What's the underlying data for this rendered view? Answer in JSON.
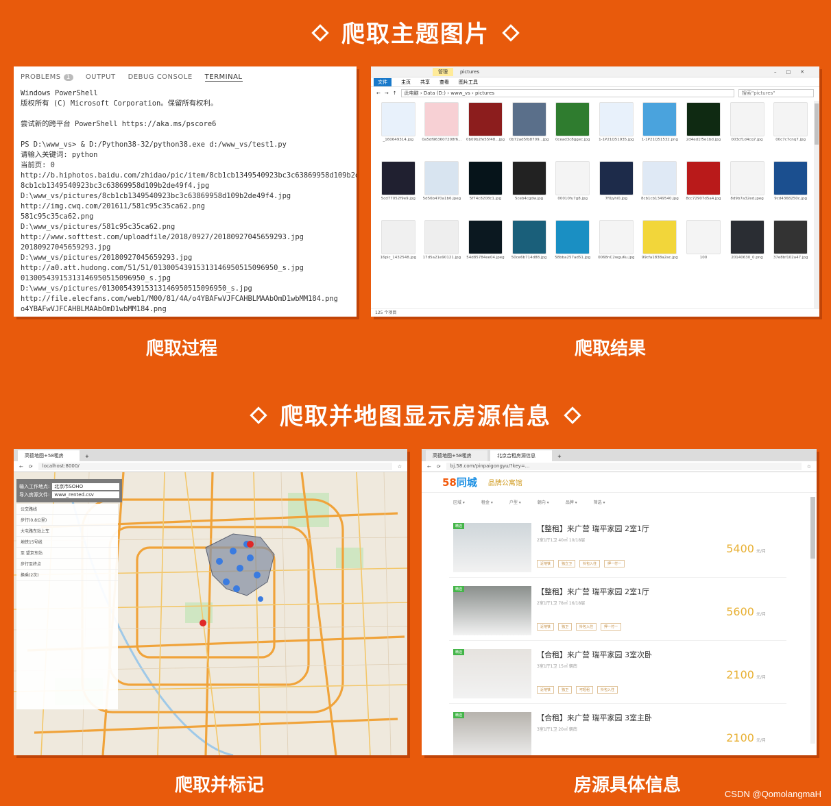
{
  "sections": {
    "top_title": "爬取主题图片",
    "bottom_title": "爬取并地图显示房源信息"
  },
  "captions": {
    "process": "爬取过程",
    "result": "爬取结果",
    "mark": "爬取并标记",
    "detail": "房源具体信息"
  },
  "terminal": {
    "tabs": [
      {
        "label": "PROBLEMS",
        "badge": "1"
      },
      {
        "label": "OUTPUT"
      },
      {
        "label": "DEBUG CONSOLE"
      },
      {
        "label": "TERMINAL"
      }
    ],
    "lines": [
      "Windows PowerShell",
      "版权所有 (C) Microsoft Corporation。保留所有权利。",
      "",
      "尝试新的跨平台 PowerShell https://aka.ms/pscore6",
      "",
      "PS D:\\www_vs> & D:/Python38-32/python38.exe d:/www_vs/test1.py",
      "请输入关键词: python",
      "当前页: 0",
      "http://b.hiphotos.baidu.com/zhidao/pic/item/8cb1cb1349540923bc3c63869958d109b2de",
      "8cb1cb1349540923bc3c63869958d109b2de49f4.jpg",
      "D:\\www_vs/pictures/8cb1cb1349540923bc3c63869958d109b2de49f4.jpg",
      "http://img.cwq.com/201611/581c95c35ca62.png",
      "581c95c35ca62.png",
      "D:\\www_vs/pictures/581c95c35ca62.png",
      "http://www.softtest.com/uploadfile/2018/0927/20180927045659293.jpg",
      "20180927045659293.jpg",
      "D:\\www_vs/pictures/20180927045659293.jpg",
      "http://a0.att.hudong.com/51/51/01300543915313146950515096950_s.jpg",
      "01300543915313146950515096950_s.jpg",
      "D:\\www_vs/pictures/01300543915313146950515096950_s.jpg",
      "http://file.elecfans.com/web1/M00/81/4A/o4YBAFwVJFCAHBLMAAbOmD1wbMM184.png",
      "o4YBAFwVJFCAHBLMAAbOmD1wbMM184.png"
    ]
  },
  "explorer": {
    "title": "pictures",
    "tool_tab": "管理",
    "ribbon": [
      "文件",
      "主页",
      "共享",
      "查看",
      "图片工具"
    ],
    "path": "此电脑 › Data (D:) › www_vs › pictures",
    "search_placeholder": "搜索\"pictures\"",
    "status": "125 个项目",
    "files": [
      {
        "name": "_160649314.jpg",
        "color": "#e8f1fb"
      },
      {
        "name": "0a5df963607208f6...",
        "color": "#f7d0d4"
      },
      {
        "name": "0b09b2fe55f48...jpg",
        "color": "#8c1d1d"
      },
      {
        "name": "0b72ad5fb8709...jpg",
        "color": "#5a6f8a"
      },
      {
        "name": "0cead3c8ggec.jpg",
        "color": "#2f7c2f"
      },
      {
        "name": "1-1P21Q51935.jpg",
        "color": "#e8f1fb"
      },
      {
        "name": "1-1P21Q51532.png",
        "color": "#4aa3dd"
      },
      {
        "name": "2d4ed1f5e1bd.jpg",
        "color": "#0f2a12"
      },
      {
        "name": "003cf1d4cq7.jpg",
        "color": "#f4f4f4"
      },
      {
        "name": "00c7c7cnq7.jpg",
        "color": "#f4f4f4"
      },
      {
        "name": "5cd77052f9e9.jpg",
        "color": "#202030"
      },
      {
        "name": "5d56b470a1b6.jpeg",
        "color": "#d8e4f0"
      },
      {
        "name": "5f74c8208c1.jpg",
        "color": "#06141a"
      },
      {
        "name": "5ceb4cgdw.jpg",
        "color": "#222"
      },
      {
        "name": "00010fu7g8.jpg",
        "color": "#f4f4f4"
      },
      {
        "name": "7f0jyhi0.jpg",
        "color": "#1d2b4a"
      },
      {
        "name": "8cb1cb1349540.jpg",
        "color": "#dfe9f5"
      },
      {
        "name": "8cc72907d5a4.jpg",
        "color": "#b91a1a"
      },
      {
        "name": "8d9b7a32ed.jpeg",
        "color": "#f4f4f4"
      },
      {
        "name": "9cd4368250c.jpg",
        "color": "#1b4f8f"
      },
      {
        "name": "16pic_1432548.jpg",
        "color": "#f0f0f0"
      },
      {
        "name": "17d5a21e90121.jpg",
        "color": "#eeeeee"
      },
      {
        "name": "54d85784ee04.jpeg",
        "color": "#0b1820"
      },
      {
        "name": "50ce6b714d88.jpg",
        "color": "#1a5f7a"
      },
      {
        "name": "58bba257ad51.jpg",
        "color": "#1a8fc3"
      },
      {
        "name": "0068nC2wguKu.jpg",
        "color": "#f4f4f4"
      },
      {
        "name": "99cfa1838a2ac.jpg",
        "color": "#f2d63a"
      },
      {
        "name": "100",
        "color": "#f4f4f4"
      },
      {
        "name": "20140630_0.png",
        "color": "#2a2d33"
      },
      {
        "name": "37e8bf102a47.jpg",
        "color": "#333333"
      }
    ]
  },
  "map": {
    "tab": "高德地图+58租房",
    "url": "localhost:8000/",
    "work_label": "输入工作地点:",
    "work_value": "北京市SOHO",
    "file_label": "导入房源文件:",
    "file_value": "www_rented.csv",
    "route_rows": [
      "公交路线",
      "步行(0.8公里)",
      "大屯路东站上车",
      "地铁15号线",
      "至 望京东站",
      "步行至终点",
      "换乘(2次)"
    ]
  },
  "listings_page": {
    "tab": "北京合租房源信息",
    "url": "bj.58.com/pinpaigongyu/?key=...",
    "logo_num": "58",
    "logo_text": "同城",
    "apart_label": "品牌公寓馆",
    "filters": [
      "区域",
      "租金",
      "户型",
      "朝向",
      "品牌",
      "筛选"
    ],
    "listings": [
      {
        "title": "【整租】来广营 瑞平家园 2室1厅",
        "sub": "2室1厅1卫  40㎡  10/18层",
        "price": "5400",
        "unit": "元/月",
        "tag": "精选",
        "chips": [
          "近地铁",
          "独立卫",
          "拎包入住",
          "押一付一"
        ]
      },
      {
        "title": "【整租】来广营 瑞平家园 2室1厅",
        "sub": "2室1厅1卫  78㎡  16/18层",
        "price": "5600",
        "unit": "元/月",
        "tag": "精选",
        "chips": [
          "近地铁",
          "独卫",
          "拎包入住",
          "押一付一"
        ]
      },
      {
        "title": "【合租】来广营 瑞平家园 3室次卧",
        "sub": "3室1厅1卫  15㎡  朝南",
        "price": "2100",
        "unit": "元/月",
        "tag": "精选",
        "chips": [
          "近地铁",
          "独卫",
          "可短租",
          "拎包入住"
        ]
      },
      {
        "title": "【合租】来广营 瑞平家园 3室主卧",
        "sub": "3室1厅1卫  20㎡  朝南",
        "price": "2100",
        "unit": "元/月",
        "tag": "精选",
        "chips": []
      }
    ]
  },
  "watermark": "CSDN @QomolangmaH"
}
